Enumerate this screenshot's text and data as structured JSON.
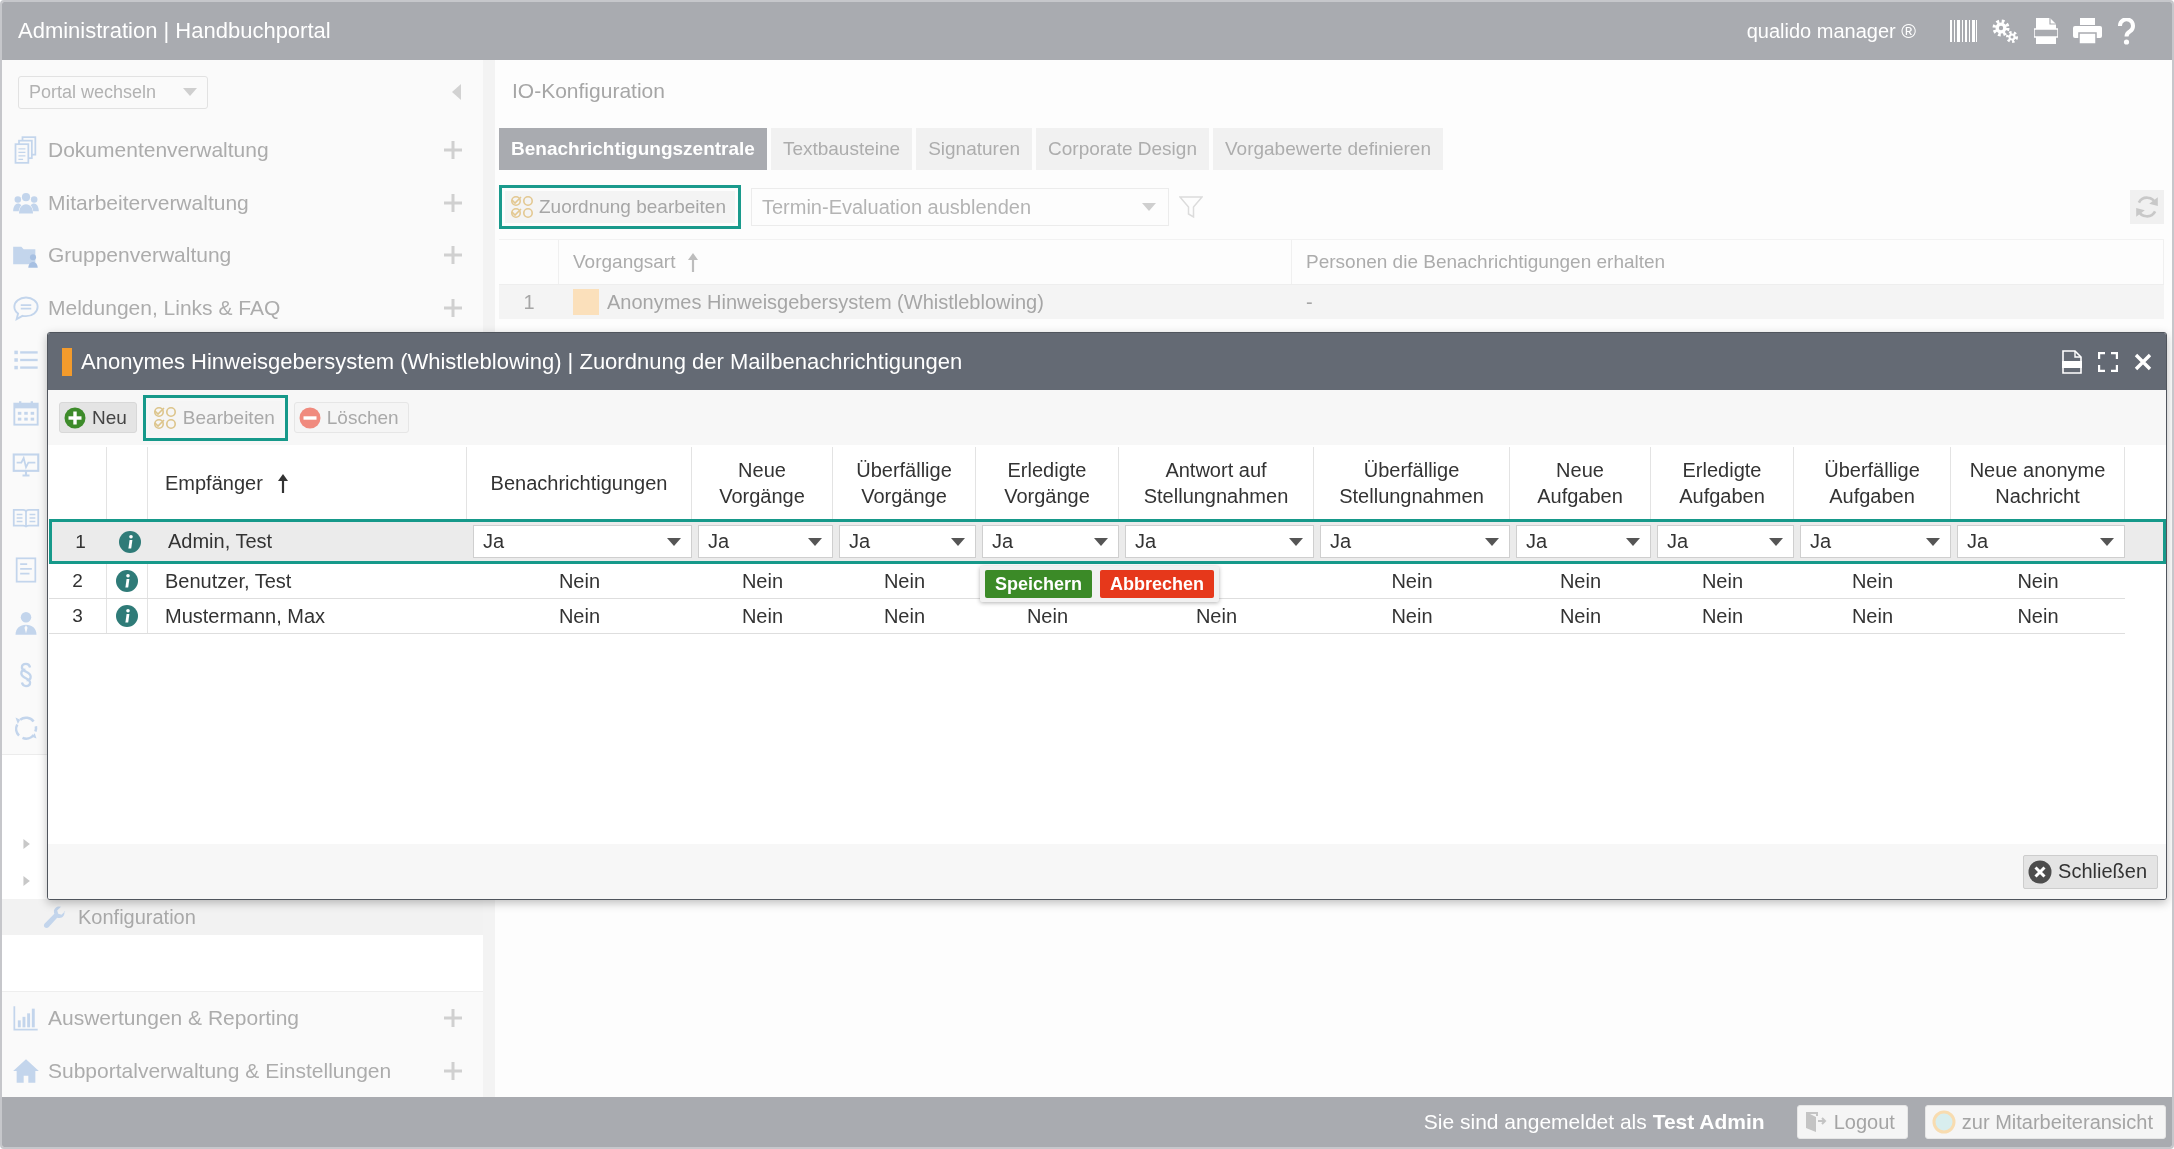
{
  "header": {
    "title": "Administration | Handbuchportal",
    "product": "qualido manager ®"
  },
  "sidebar": {
    "portal_select": {
      "value": "Portal wechseln"
    },
    "items": [
      {
        "kind": "entry",
        "label": "Dokumentenverwaltung"
      },
      {
        "kind": "entry",
        "label": "Mitarbeiterverwaltung"
      },
      {
        "kind": "entry",
        "label": "Gruppenverwaltung"
      },
      {
        "kind": "entry",
        "label": "Meldungen, Links & FAQ"
      },
      {
        "kind": "covered"
      },
      {
        "kind": "covered"
      },
      {
        "kind": "covered"
      },
      {
        "kind": "covered"
      },
      {
        "kind": "covered"
      },
      {
        "kind": "covered"
      },
      {
        "kind": "covered"
      },
      {
        "kind": "covered"
      }
    ],
    "subtree": {
      "folders": [
        {
          "expanded": false
        },
        {
          "expanded": false
        }
      ],
      "pages": [
        {
          "label": "Konfiguration",
          "selected": true
        }
      ]
    },
    "bottom_items": [
      {
        "kind": "entry",
        "label": "Auswertungen & Reporting"
      },
      {
        "kind": "entry",
        "label": "Subportalverwaltung & Einstellungen"
      }
    ]
  },
  "main": {
    "title": "IO-Konfiguration",
    "tabs": [
      {
        "label": "Benachrichtigungszentrale",
        "selected": true
      },
      {
        "label": "Textbausteine",
        "selected": false
      },
      {
        "label": "Signaturen",
        "selected": false
      },
      {
        "label": "Corporate Design",
        "selected": false
      },
      {
        "label": "Vorgabewerte definieren",
        "selected": false
      }
    ],
    "toolbar": {
      "edit_button": {
        "label": "Zuordnung bearbeiten",
        "focused": true
      },
      "filter_select": {
        "value": "Termin-Evaluation ausblenden"
      }
    },
    "table": {
      "columns": [
        {
          "label": "Vorgangsart",
          "sorted": true
        },
        {
          "label": "Personen die Benachrichtigungen erhalten",
          "sorted": false
        }
      ],
      "rows": [
        {
          "number": "1",
          "color": "#fbe0bb",
          "name": "Anonymes Hinweisgebersystem (Whistleblowing)",
          "persons": "-"
        }
      ]
    }
  },
  "dialog": {
    "title": "Anonymes Hinweisgebersystem (Whistleblowing) | Zuordnung der Mailbenachrichtigungen",
    "toolbar": [
      {
        "kind": "add",
        "label": "Neu",
        "disabled": false,
        "focused": false
      },
      {
        "kind": "edit",
        "label": "Bearbeiten",
        "disabled": true,
        "focused": true
      },
      {
        "kind": "delete",
        "label": "Löschen",
        "disabled": true,
        "focused": false
      }
    ],
    "table": {
      "columns": [
        {
          "kind": "blank"
        },
        {
          "kind": "blank"
        },
        {
          "kind": "header",
          "label": "Empfänger",
          "sorted": true
        },
        {
          "kind": "header",
          "label": "Benachrichtigungen",
          "sorted": false
        },
        {
          "kind": "header",
          "label": "Neue Vorgänge",
          "sorted": false
        },
        {
          "kind": "header",
          "label": "Überfällige Vorgänge",
          "sorted": false
        },
        {
          "kind": "header",
          "label": "Erledigte Vorgänge",
          "sorted": false
        },
        {
          "kind": "header",
          "label": "Antwort auf Stellungnahmen",
          "sorted": false
        },
        {
          "kind": "header",
          "label": "Überfällige Stellungnahmen",
          "sorted": false
        },
        {
          "kind": "header",
          "label": "Neue Aufgaben",
          "sorted": false
        },
        {
          "kind": "header",
          "label": "Erledigte Aufgaben",
          "sorted": false
        },
        {
          "kind": "header",
          "label": "Überfällige Aufgaben",
          "sorted": false
        },
        {
          "kind": "header",
          "label": "Neue anonyme Nachricht",
          "sorted": false
        }
      ],
      "rows": [
        {
          "selected": true,
          "editing": true,
          "cells": [
            {
              "kind": "number",
              "text": "1"
            },
            {
              "kind": "info"
            },
            {
              "kind": "name",
              "text": "Admin, Test"
            },
            {
              "kind": "value",
              "text": "Ja"
            },
            {
              "kind": "value",
              "text": "Ja"
            },
            {
              "kind": "value",
              "text": "Ja"
            },
            {
              "kind": "value",
              "text": "Ja"
            },
            {
              "kind": "value",
              "text": "Ja"
            },
            {
              "kind": "value",
              "text": "Ja"
            },
            {
              "kind": "value",
              "text": "Ja"
            },
            {
              "kind": "value",
              "text": "Ja"
            },
            {
              "kind": "value",
              "text": "Ja"
            },
            {
              "kind": "value",
              "text": "Ja"
            }
          ]
        },
        {
          "selected": false,
          "editing": false,
          "cells": [
            {
              "kind": "number",
              "text": "2"
            },
            {
              "kind": "info"
            },
            {
              "kind": "name",
              "text": "Benutzer, Test"
            },
            {
              "kind": "value",
              "text": "Nein"
            },
            {
              "kind": "value",
              "text": "Nein"
            },
            {
              "kind": "value",
              "text": "Nein"
            },
            {
              "kind": "covered"
            },
            {
              "kind": "covered"
            },
            {
              "kind": "value",
              "text": "Nein"
            },
            {
              "kind": "value",
              "text": "Nein"
            },
            {
              "kind": "value",
              "text": "Nein"
            },
            {
              "kind": "value",
              "text": "Nein"
            },
            {
              "kind": "value",
              "text": "Nein"
            }
          ]
        },
        {
          "selected": false,
          "editing": false,
          "cells": [
            {
              "kind": "number",
              "text": "3"
            },
            {
              "kind": "info"
            },
            {
              "kind": "name",
              "text": "Mustermann, Max"
            },
            {
              "kind": "value",
              "text": "Nein"
            },
            {
              "kind": "value",
              "text": "Nein"
            },
            {
              "kind": "value",
              "text": "Nein"
            },
            {
              "kind": "value",
              "text": "Nein"
            },
            {
              "kind": "value",
              "text": "Nein"
            },
            {
              "kind": "value",
              "text": "Nein"
            },
            {
              "kind": "value",
              "text": "Nein"
            },
            {
              "kind": "value",
              "text": "Nein"
            },
            {
              "kind": "value",
              "text": "Nein"
            },
            {
              "kind": "value",
              "text": "Nein"
            }
          ]
        }
      ]
    },
    "edit_actions": [
      {
        "kind": "save",
        "label": "Speichern"
      },
      {
        "kind": "cancel",
        "label": "Abbrechen"
      }
    ],
    "close_button": {
      "label": "Schließen"
    }
  },
  "footer": {
    "login_text": "Sie sind angemeldet als **Test Admin**",
    "buttons": [
      {
        "kind": "logout",
        "label": "Logout"
      },
      {
        "kind": "employee_view",
        "label": "zur Mitarbeiteransicht"
      }
    ]
  }
}
